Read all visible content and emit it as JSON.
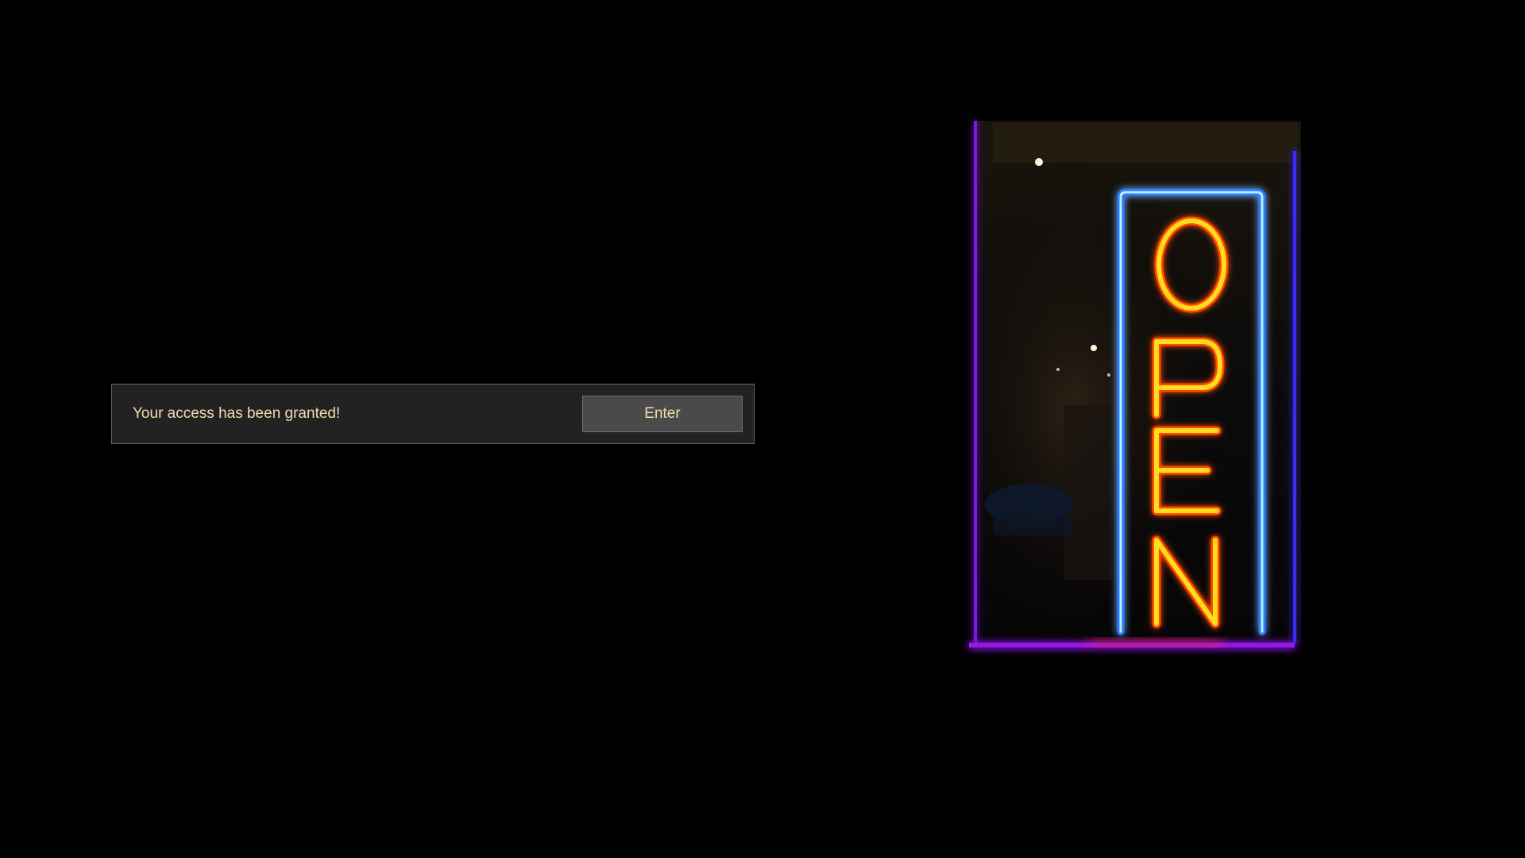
{
  "notification": {
    "message": "Your access has been granted!",
    "enter_label": "Enter"
  },
  "sign": {
    "text": "OPEN",
    "icon": "neon-open-sign",
    "letter_color": "#ffd21a",
    "border_color": "#2f8cff",
    "frame_color": "#8a1cff"
  },
  "colors": {
    "background": "#000000",
    "panel": "#222222",
    "panel_border": "#6a6a6a",
    "button": "#4a4a4a",
    "text": "#f1dcb0"
  }
}
